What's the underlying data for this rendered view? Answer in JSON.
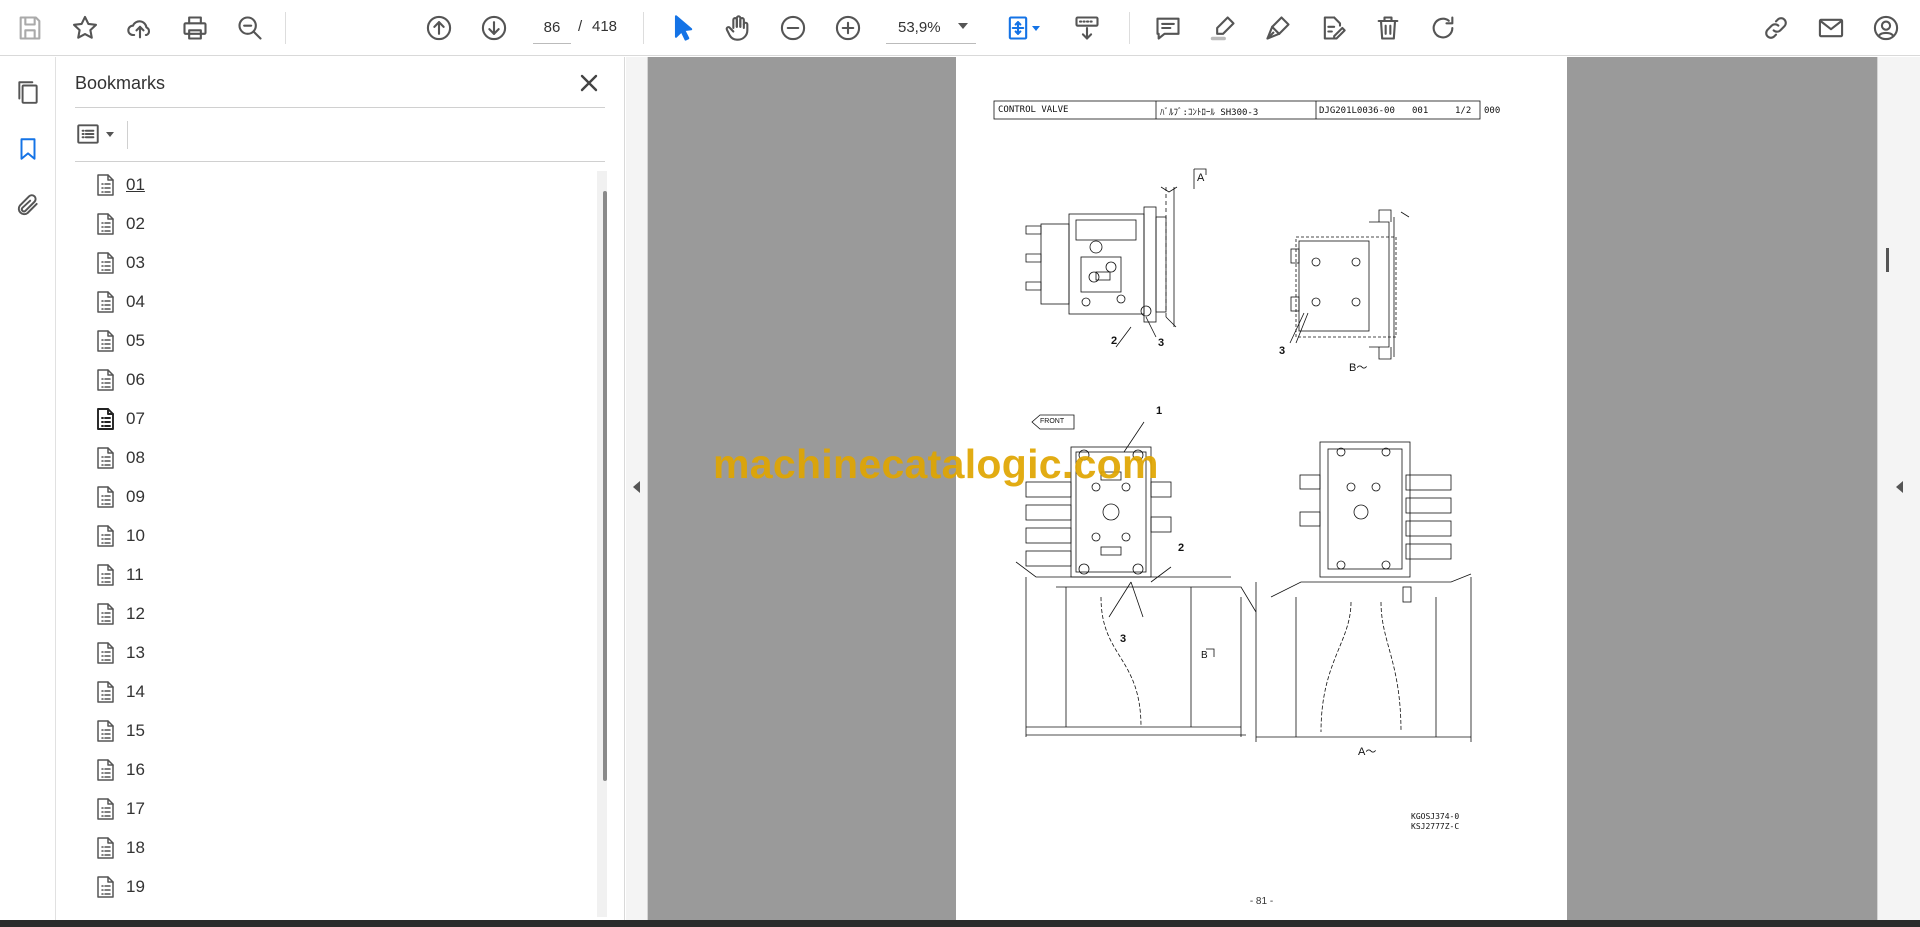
{
  "toolbar": {
    "current_page": "86",
    "page_separator": "/",
    "total_pages": "418",
    "zoom_level": "53,9%",
    "icons": [
      "save-icon",
      "star-icon",
      "upload-cloud-icon",
      "print-icon",
      "zoom-search-icon",
      "page-up-icon",
      "page-down-icon",
      "select-pointer-icon",
      "hand-icon",
      "zoom-out-icon",
      "zoom-in-icon",
      "page-fit-icon",
      "scroll-mode-icon",
      "comment-icon",
      "highlight-icon",
      "draw-icon",
      "edit-pdf-icon",
      "delete-icon",
      "rotate-icon",
      "share-link-icon",
      "email-icon",
      "account-icon"
    ],
    "accent_color": "#1473e6"
  },
  "rail": {
    "icons": [
      "pages-icon",
      "bookmark-icon",
      "attachment-icon"
    ],
    "active": "bookmark-icon"
  },
  "bookmarks": {
    "title": "Bookmarks",
    "items": [
      "01",
      "02",
      "03",
      "04",
      "05",
      "06",
      "07",
      "08",
      "09",
      "10",
      "11",
      "12",
      "13",
      "14",
      "15",
      "16",
      "17",
      "18",
      "19"
    ],
    "selected_item": "07"
  },
  "page": {
    "header_part": "CONTROL VALVE",
    "header_jp": "ﾊﾞﾙﾌﾞ:ｺﾝﾄﾛｰﾙ SH300-3",
    "header_code": "DJG201L0036-00",
    "header_seq": "001",
    "header_sheet": "1/2",
    "header_extra": "000",
    "view_a_marker": "A",
    "view_b_marker": "B",
    "view_b_label": "B～",
    "view_a_label": "A～",
    "front_label": "FRONT",
    "callouts": [
      "1",
      "2",
      "3"
    ],
    "ref_codes": [
      "KGOSJ374-0",
      "KSJ2777Z-C"
    ],
    "page_number": "- 81 -"
  },
  "watermark": "machinecatalogic.com"
}
